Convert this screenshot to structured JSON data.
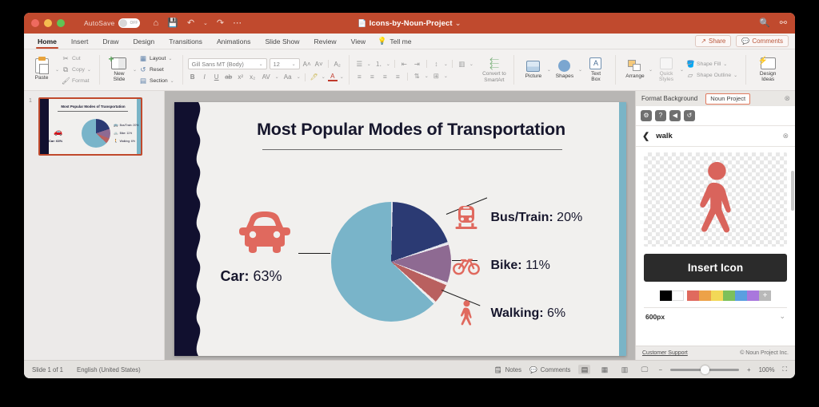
{
  "window": {
    "app_title": "Icons-by-Noun-Project",
    "autosave_label": "AutoSave",
    "autosave_state": "OFF",
    "title_caret": "⌄",
    "file_icon": "📄",
    "home_icon": "⌂",
    "save_icon": "💾",
    "undo_icon": "↶",
    "undo_caret": "⌄",
    "redo_icon": "↷",
    "more_icon": "⋯",
    "search_icon": "🔍",
    "share_titlebar_icon": "⚯"
  },
  "tabs": [
    {
      "label": "Home",
      "active": true
    },
    {
      "label": "Insert",
      "active": false
    },
    {
      "label": "Draw",
      "active": false
    },
    {
      "label": "Design",
      "active": false
    },
    {
      "label": "Transitions",
      "active": false
    },
    {
      "label": "Animations",
      "active": false
    },
    {
      "label": "Slide Show",
      "active": false
    },
    {
      "label": "Review",
      "active": false
    },
    {
      "label": "View",
      "active": false
    }
  ],
  "tell_me": {
    "label": "Tell me",
    "icon": "💡"
  },
  "tabs_right": {
    "share_label": "Share",
    "share_icon": "↗",
    "comments_label": "Comments",
    "comments_icon": "💬"
  },
  "ribbon": {
    "clipboard": {
      "paste_label": "Paste",
      "cut_label": "Cut",
      "copy_label": "Copy",
      "format_label": "Format",
      "cut_icon": "✂",
      "copy_icon": "⧉",
      "format_icon": "🖌",
      "caret": "⌄"
    },
    "slides": {
      "new_slide_label": "New\nSlide",
      "new_slide_line1": "New",
      "new_slide_line2": "Slide",
      "layout_label": "Layout",
      "reset_label": "Reset",
      "section_label": "Section",
      "layout_icon": "▦",
      "reset_icon": "↺",
      "section_icon": "▤",
      "caret": "⌄"
    },
    "font": {
      "family_value": "Gill Sans MT (Body)",
      "size_value": "12",
      "grow_icon": "A˄",
      "shrink_icon": "A˅",
      "clear_format_icon": "A₂",
      "bold": "B",
      "italic": "I",
      "underline": "U",
      "strikethrough": "ab",
      "superscript": "x²",
      "subscript": "x₂",
      "spacing_icon": "AV",
      "case_icon": "Aa",
      "highlight_icon": "🖊",
      "fontcolor_icon": "A",
      "caret": "⌄"
    },
    "paragraph": {
      "bullets_icon": "☰",
      "numbering_icon": "⒈",
      "decrease_indent_icon": "⇤",
      "increase_indent_icon": "⇥",
      "line_spacing_icon": "↕",
      "columns_icon": "▥",
      "align_left_icon": "≡",
      "align_center_icon": "≡",
      "align_right_icon": "≡",
      "justify_icon": "≡",
      "text_direction_icon": "⇅",
      "align_text_icon": "⊞",
      "smartart_label_line1": "Convert to",
      "smartart_label_line2": "SmartArt",
      "caret": "⌄"
    },
    "insert": {
      "picture_label": "Picture",
      "shapes_label": "Shapes",
      "textbox_line1": "Text",
      "textbox_line2": "Box",
      "caret": "⌄"
    },
    "drawing": {
      "arrange_label": "Arrange",
      "quick_styles_line1": "Quick",
      "quick_styles_line2": "Styles",
      "shape_fill_label": "Shape Fill",
      "shape_outline_label": "Shape Outline",
      "shape_fill_icon": "🪣",
      "shape_outline_icon": "▱",
      "caret": "⌄"
    },
    "designer": {
      "label_line1": "Design",
      "label_line2": "Ideas"
    }
  },
  "thumbnails": {
    "slides": [
      {
        "number": "1",
        "title": "Most Popular Modes of Transportation",
        "car_label": "Car: 63%",
        "legend": [
          "Bus/Train: 20%",
          "Bike: 11%",
          "Walking: 6%"
        ],
        "selected": true
      }
    ]
  },
  "slide": {
    "title": "Most Popular Modes of Transportation",
    "car_name": "Car:",
    "car_value": " 63%",
    "legend": [
      {
        "icon": "bus-train-icon",
        "name": "Bus/Train:",
        "value": " 20%"
      },
      {
        "icon": "bike-icon",
        "name": "Bike:",
        "value": " 11%"
      },
      {
        "icon": "walking-icon",
        "name": "Walking:",
        "value": " 6%"
      }
    ]
  },
  "chart_data": {
    "type": "pie",
    "title": "Most Popular Modes of Transportation",
    "categories": [
      "Bus/Train",
      "Bike",
      "Walking",
      "Car"
    ],
    "values": [
      20,
      11,
      6,
      63
    ],
    "unit": "%",
    "colors": [
      "#2b3a73",
      "#8e6a92",
      "#b9605f",
      "#79b4c9"
    ],
    "labels": [
      "Bus/Train: 20%",
      "Bike: 11%",
      "Walking: 6%",
      "Car: 63%"
    ],
    "legend_position": "right-and-left",
    "start_angle_deg": 0
  },
  "panel": {
    "tab_format_background": "Format Background",
    "tab_noun_project": "Noun Project",
    "close_icon": "⊗",
    "toolbar_icons": [
      {
        "name": "settings-icon",
        "glyph": "⚙"
      },
      {
        "name": "help-icon",
        "glyph": "?"
      },
      {
        "name": "collections-icon",
        "glyph": "◀"
      },
      {
        "name": "history-icon",
        "glyph": "↺"
      }
    ],
    "back_icon": "❮",
    "search_term": "walk",
    "clear_icon": "⊗",
    "insert_button": "Insert Icon",
    "size_value": "600px",
    "size_caret": "⌄",
    "colors": [
      "#000000",
      "#ffffff",
      "#e06a5e",
      "#eda248",
      "#f2d857",
      "#7cc05a",
      "#5b9fe0",
      "#a977dd"
    ],
    "add_color_icon": "+",
    "customer_support": "Customer Support",
    "copyright": "© Noun Project Inc."
  },
  "status": {
    "slide_count": "Slide 1 of 1",
    "language": "English (United States)",
    "notes_label": "Notes",
    "notes_icon": "🗒",
    "comments_label": "Comments",
    "comments_icon": "💬",
    "view_normal_icon": "▤",
    "view_sorter_icon": "▦",
    "view_reading_icon": "▥",
    "view_show_icon": "🖵",
    "zoom_out_icon": "−",
    "zoom_in_icon": "+",
    "zoom_value": "100%",
    "fit_icon": "⛶"
  }
}
